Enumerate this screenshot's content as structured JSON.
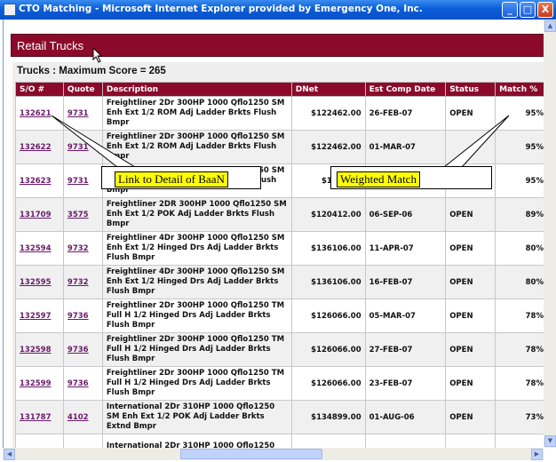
{
  "window": {
    "title": "CTO Matching - Microsoft Internet Explorer provided by Emergency One, Inc.",
    "buttons": [
      "_",
      "□",
      "X"
    ]
  },
  "panel": {
    "title": "Retail Trucks",
    "score_label": "Trucks : Maximum Score = 265"
  },
  "table": {
    "headers": [
      "S/O #",
      "Quote",
      "Description",
      "DNet",
      "Est Comp Date",
      "Status",
      "Match %"
    ],
    "rows": [
      {
        "so": "132621",
        "quote": "9731",
        "desc": "Freightliner 2Dr 300HP 1000 Qflo1250 SM Enh Ext 1/2 ROM Adj Ladder Brkts Flush Bmpr",
        "dnet": "$122462.00",
        "date": "26-FEB-07",
        "status": "OPEN",
        "match": "95%"
      },
      {
        "so": "132622",
        "quote": "9731",
        "desc": "Freightliner 2Dr 300HP 1000 Qflo1250 SM Enh Ext 1/2 ROM Adj Ladder Brkts Flush Bmpr",
        "dnet": "$122462.00",
        "date": "01-MAR-07",
        "status": "",
        "match": "95%"
      },
      {
        "so": "132623",
        "quote": "9731",
        "desc": "Freightliner 2Dr 300HP 1000 Qflo1250 SM Enh Ext 1/2 ROM Adj Ladder Brkts Flush Bmpr",
        "dnet": "$122462.",
        "date": "",
        "status": "",
        "match": "95%"
      },
      {
        "so": "131709",
        "quote": "3575",
        "desc": "Freightliner 2DR 300HP 1000 Qflo1250 SM Enh Ext 1/2 POK Adj Ladder Brkts Flush Bmpr",
        "dnet": "$120412.00",
        "date": "06-SEP-06",
        "status": "OPEN",
        "match": "89%"
      },
      {
        "so": "132594",
        "quote": "9732",
        "desc": "Freightliner 4Dr 300HP 1000 Qflo1250 SM Enh Ext 1/2 Hinged Drs Adj Ladder Brkts Flush Bmpr",
        "dnet": "$136106.00",
        "date": "11-APR-07",
        "status": "OPEN",
        "match": "80%"
      },
      {
        "so": "132595",
        "quote": "9732",
        "desc": "Freightliner 4Dr 300HP 1000 Qflo1250 SM Enh Ext 1/2 Hinged Drs Adj Ladder Brkts Flush Bmpr",
        "dnet": "$136106.00",
        "date": "16-FEB-07",
        "status": "OPEN",
        "match": "80%"
      },
      {
        "so": "132597",
        "quote": "9736",
        "desc": "Freightliner 2Dr 300HP 1000 Qflo1250 TM Full H 1/2 Hinged Drs Adj Ladder Brkts Flush Bmpr",
        "dnet": "$126066.00",
        "date": "05-MAR-07",
        "status": "OPEN",
        "match": "78%"
      },
      {
        "so": "132598",
        "quote": "9736",
        "desc": "Freightliner 2Dr 300HP 1000 Qflo1250 TM Full H 1/2 Hinged Drs Adj Ladder Brkts Flush Bmpr",
        "dnet": "$126066.00",
        "date": "27-FEB-07",
        "status": "OPEN",
        "match": "78%"
      },
      {
        "so": "132599",
        "quote": "9736",
        "desc": "Freightliner 2Dr 300HP 1000 Qflo1250 TM Full H 1/2 Hinged Drs Adj Ladder Brkts Flush Bmpr",
        "dnet": "$126066.00",
        "date": "23-FEB-07",
        "status": "OPEN",
        "match": "78%"
      },
      {
        "so": "131787",
        "quote": "4102",
        "desc": "International 2Dr 310HP 1000 Qflo1250 SM Enh Ext 1/2 POK Adj Ladder Brkts Extnd Bmpr",
        "dnet": "$134899.00",
        "date": "01-AUG-06",
        "status": "OPEN",
        "match": "73%"
      },
      {
        "so": "",
        "quote": "",
        "desc": "International 2Dr 310HP 1000 Qflo1250 SM",
        "dnet": "",
        "date": "",
        "status": "",
        "match": ""
      }
    ]
  },
  "callouts": {
    "left": "Link to Detail of BaaN",
    "right": "Weighted Match"
  },
  "colors": {
    "header_bg": "#8b0a2b",
    "callout_bg": "#ffff00",
    "link": "#6a1a6a"
  }
}
